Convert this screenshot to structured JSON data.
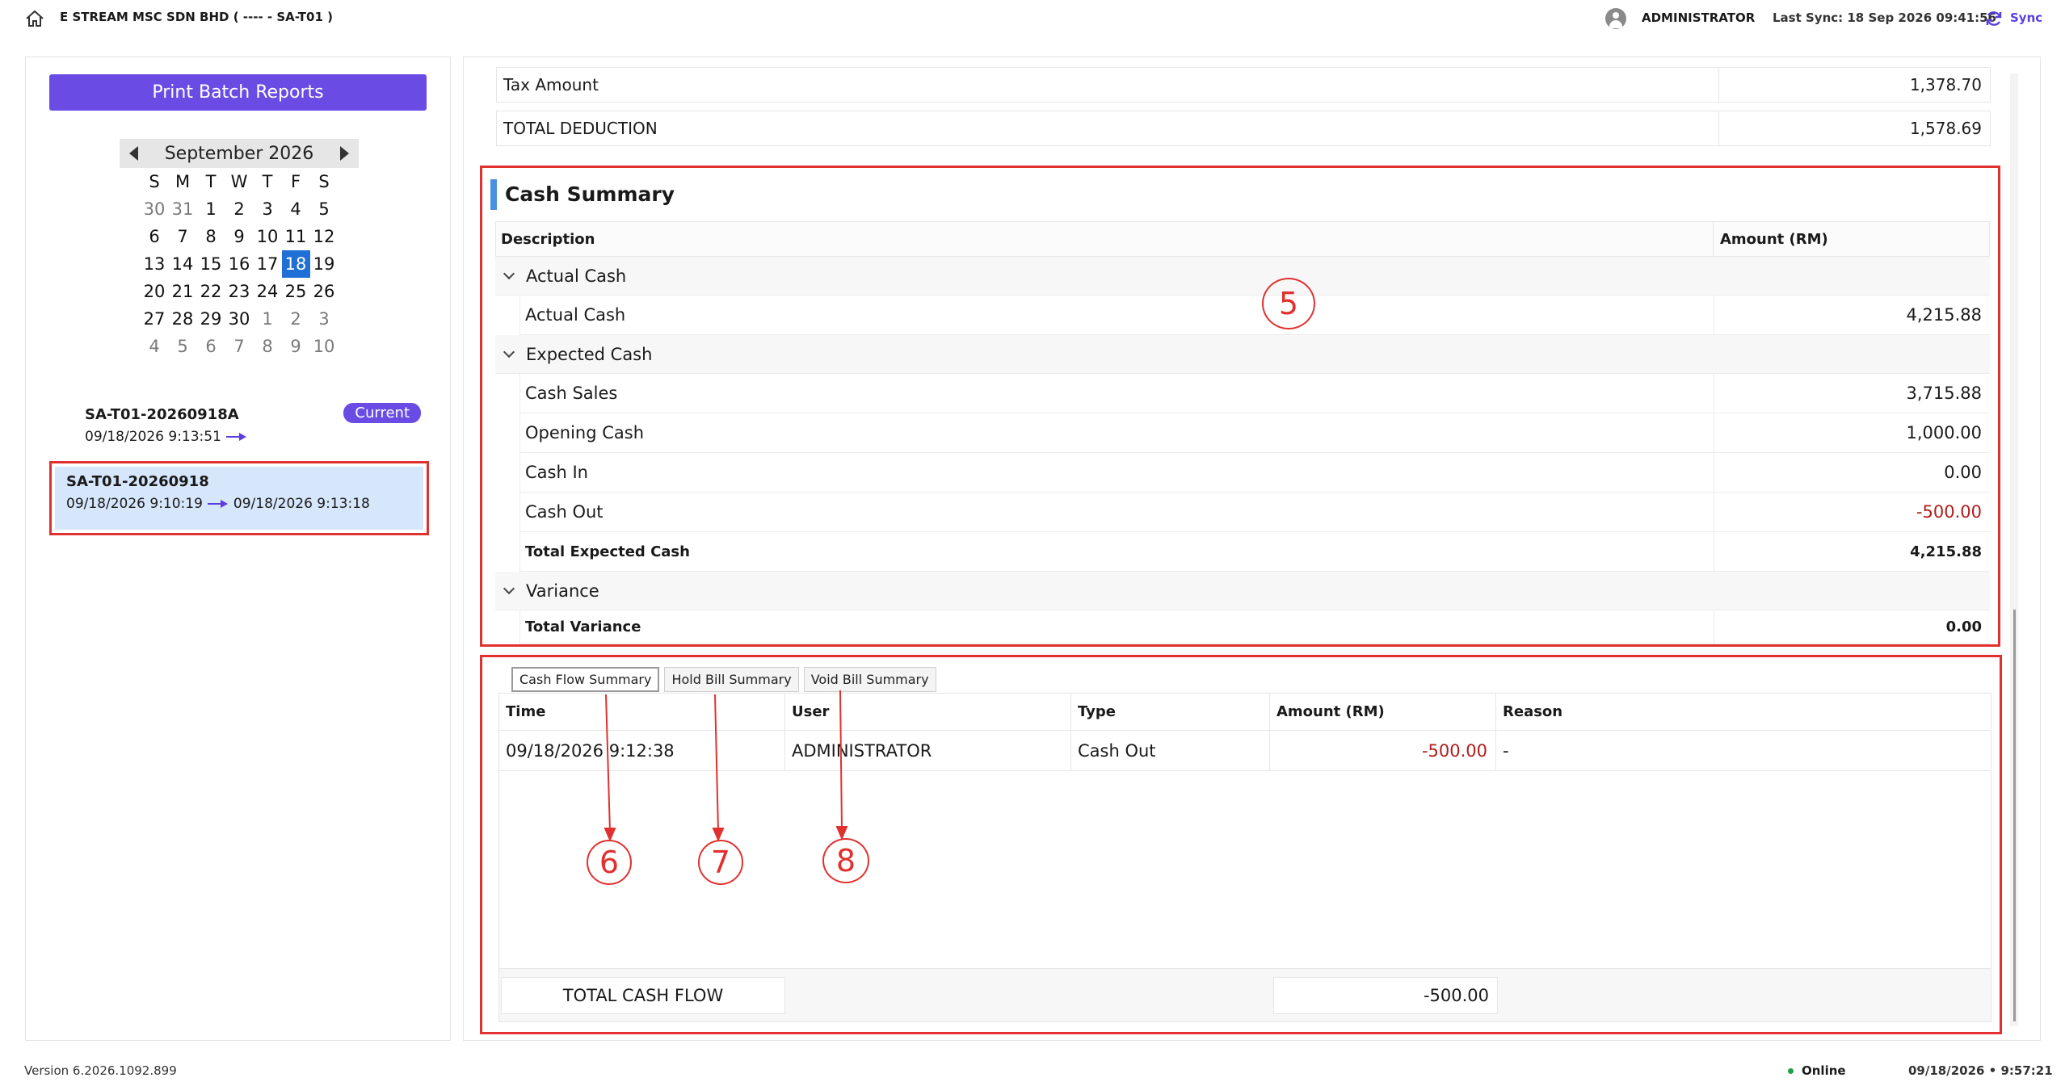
{
  "header": {
    "company": "E STREAM MSC SDN BHD ( ---- - SA-T01 )",
    "username": "ADMINISTRATOR",
    "last_sync": "Last Sync: 18 Sep 2026 09:41:56",
    "sync_label": "Sync",
    "icons": {
      "home": "home-icon",
      "user": "user-avatar-icon",
      "sync": "sync-icon"
    }
  },
  "left": {
    "print_button": "Print Batch Reports",
    "calendar": {
      "month_label": "September 2026",
      "weekdays": [
        "S",
        "M",
        "T",
        "W",
        "T",
        "F",
        "S"
      ],
      "weeks": [
        [
          "30",
          "31",
          "1",
          "2",
          "3",
          "4",
          "5"
        ],
        [
          "6",
          "7",
          "8",
          "9",
          "10",
          "11",
          "12"
        ],
        [
          "13",
          "14",
          "15",
          "16",
          "17",
          "18",
          "19"
        ],
        [
          "20",
          "21",
          "22",
          "23",
          "24",
          "25",
          "26"
        ],
        [
          "27",
          "28",
          "29",
          "30",
          "1",
          "2",
          "3"
        ],
        [
          "4",
          "5",
          "6",
          "7",
          "8",
          "9",
          "10"
        ]
      ],
      "selected": "18"
    },
    "batches": [
      {
        "id": "SA-T01-20260918A",
        "start": "09/18/2026 9:13:51",
        "end": "",
        "badge": "Current"
      },
      {
        "id": "SA-T01-20260918",
        "start": "09/18/2026 9:10:19",
        "end": "09/18/2026 9:13:18",
        "badge": ""
      }
    ]
  },
  "deductions": [
    {
      "label": "Tax Amount",
      "value": "1,378.70"
    },
    {
      "label": "TOTAL DEDUCTION",
      "value": "1,578.69"
    }
  ],
  "cash_summary": {
    "title": "Cash Summary",
    "col_description": "Description",
    "col_amount": "Amount (RM)",
    "groups": [
      {
        "label": "Actual Cash",
        "rows": [
          {
            "label": "Actual Cash",
            "value": "4,215.88"
          }
        ]
      },
      {
        "label": "Expected Cash",
        "rows": [
          {
            "label": "Cash Sales",
            "value": "3,715.88"
          },
          {
            "label": "Opening Cash",
            "value": "1,000.00"
          },
          {
            "label": "Cash In",
            "value": "0.00"
          },
          {
            "label": "Cash Out",
            "value": "-500.00"
          },
          {
            "label": "Total Expected Cash",
            "value": "4,215.88"
          }
        ]
      },
      {
        "label": "Variance",
        "rows": [
          {
            "label": "Total Variance",
            "value": "0.00"
          }
        ]
      }
    ]
  },
  "cash_flow": {
    "tabs": [
      "Cash Flow Summary",
      "Hold Bill Summary",
      "Void Bill Summary"
    ],
    "columns": [
      "Time",
      "User",
      "Type",
      "Amount (RM)",
      "Reason"
    ],
    "rows": [
      {
        "time": "09/18/2026 9:12:38",
        "user": "ADMINISTRATOR",
        "type": "Cash Out",
        "amount": "-500.00",
        "reason": "-"
      }
    ],
    "total_label": "TOTAL CASH FLOW",
    "total_value": "-500.00"
  },
  "annotations": [
    "5",
    "6",
    "7",
    "8"
  ],
  "footer": {
    "version": "Version 6.2026.1092.899",
    "status": "Online",
    "datetime": "09/18/2026  •  9:57:21"
  },
  "colors": {
    "accent": "#6a4ce5",
    "highlight": "#e0312f",
    "selected_day": "#1f6fd6",
    "negative": "#b21c1c"
  }
}
